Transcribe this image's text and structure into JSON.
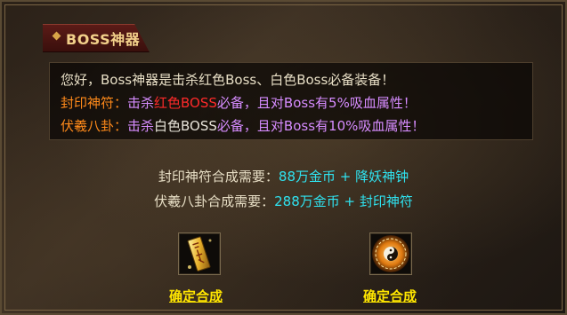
{
  "panel": {
    "title": "BOSS神器"
  },
  "info": {
    "line1": "您好，Boss神器是击杀红色Boss、白色Boss必备装备！",
    "line2": {
      "label": "封印神符：",
      "pre": "击杀",
      "highlight": "红色BOSS",
      "post": "必备，且对Boss有5%吸血属性！"
    },
    "line3": {
      "label": "伏羲八卦：",
      "pre": "击杀",
      "highlight": "白色BOSS",
      "post": "必备，且对Boss有10%吸血属性！"
    }
  },
  "requirements": [
    {
      "label": "封印神符合成需要：",
      "value": "88万金币  + 降妖神钟"
    },
    {
      "label": "伏羲八卦合成需要：",
      "value": "288万金币 + 封印神符"
    }
  ],
  "items": [
    {
      "icon": "talisman-scroll-icon",
      "button_label": "确定合成"
    },
    {
      "icon": "bagua-compass-icon",
      "button_label": "确定合成"
    }
  ],
  "colors": {
    "accent_orange": "#ff8a1a",
    "accent_violet": "#d68cff",
    "highlight_red": "#ff2a2a",
    "value_cyan": "#2fe3f0",
    "button_yellow": "#ffe600"
  }
}
